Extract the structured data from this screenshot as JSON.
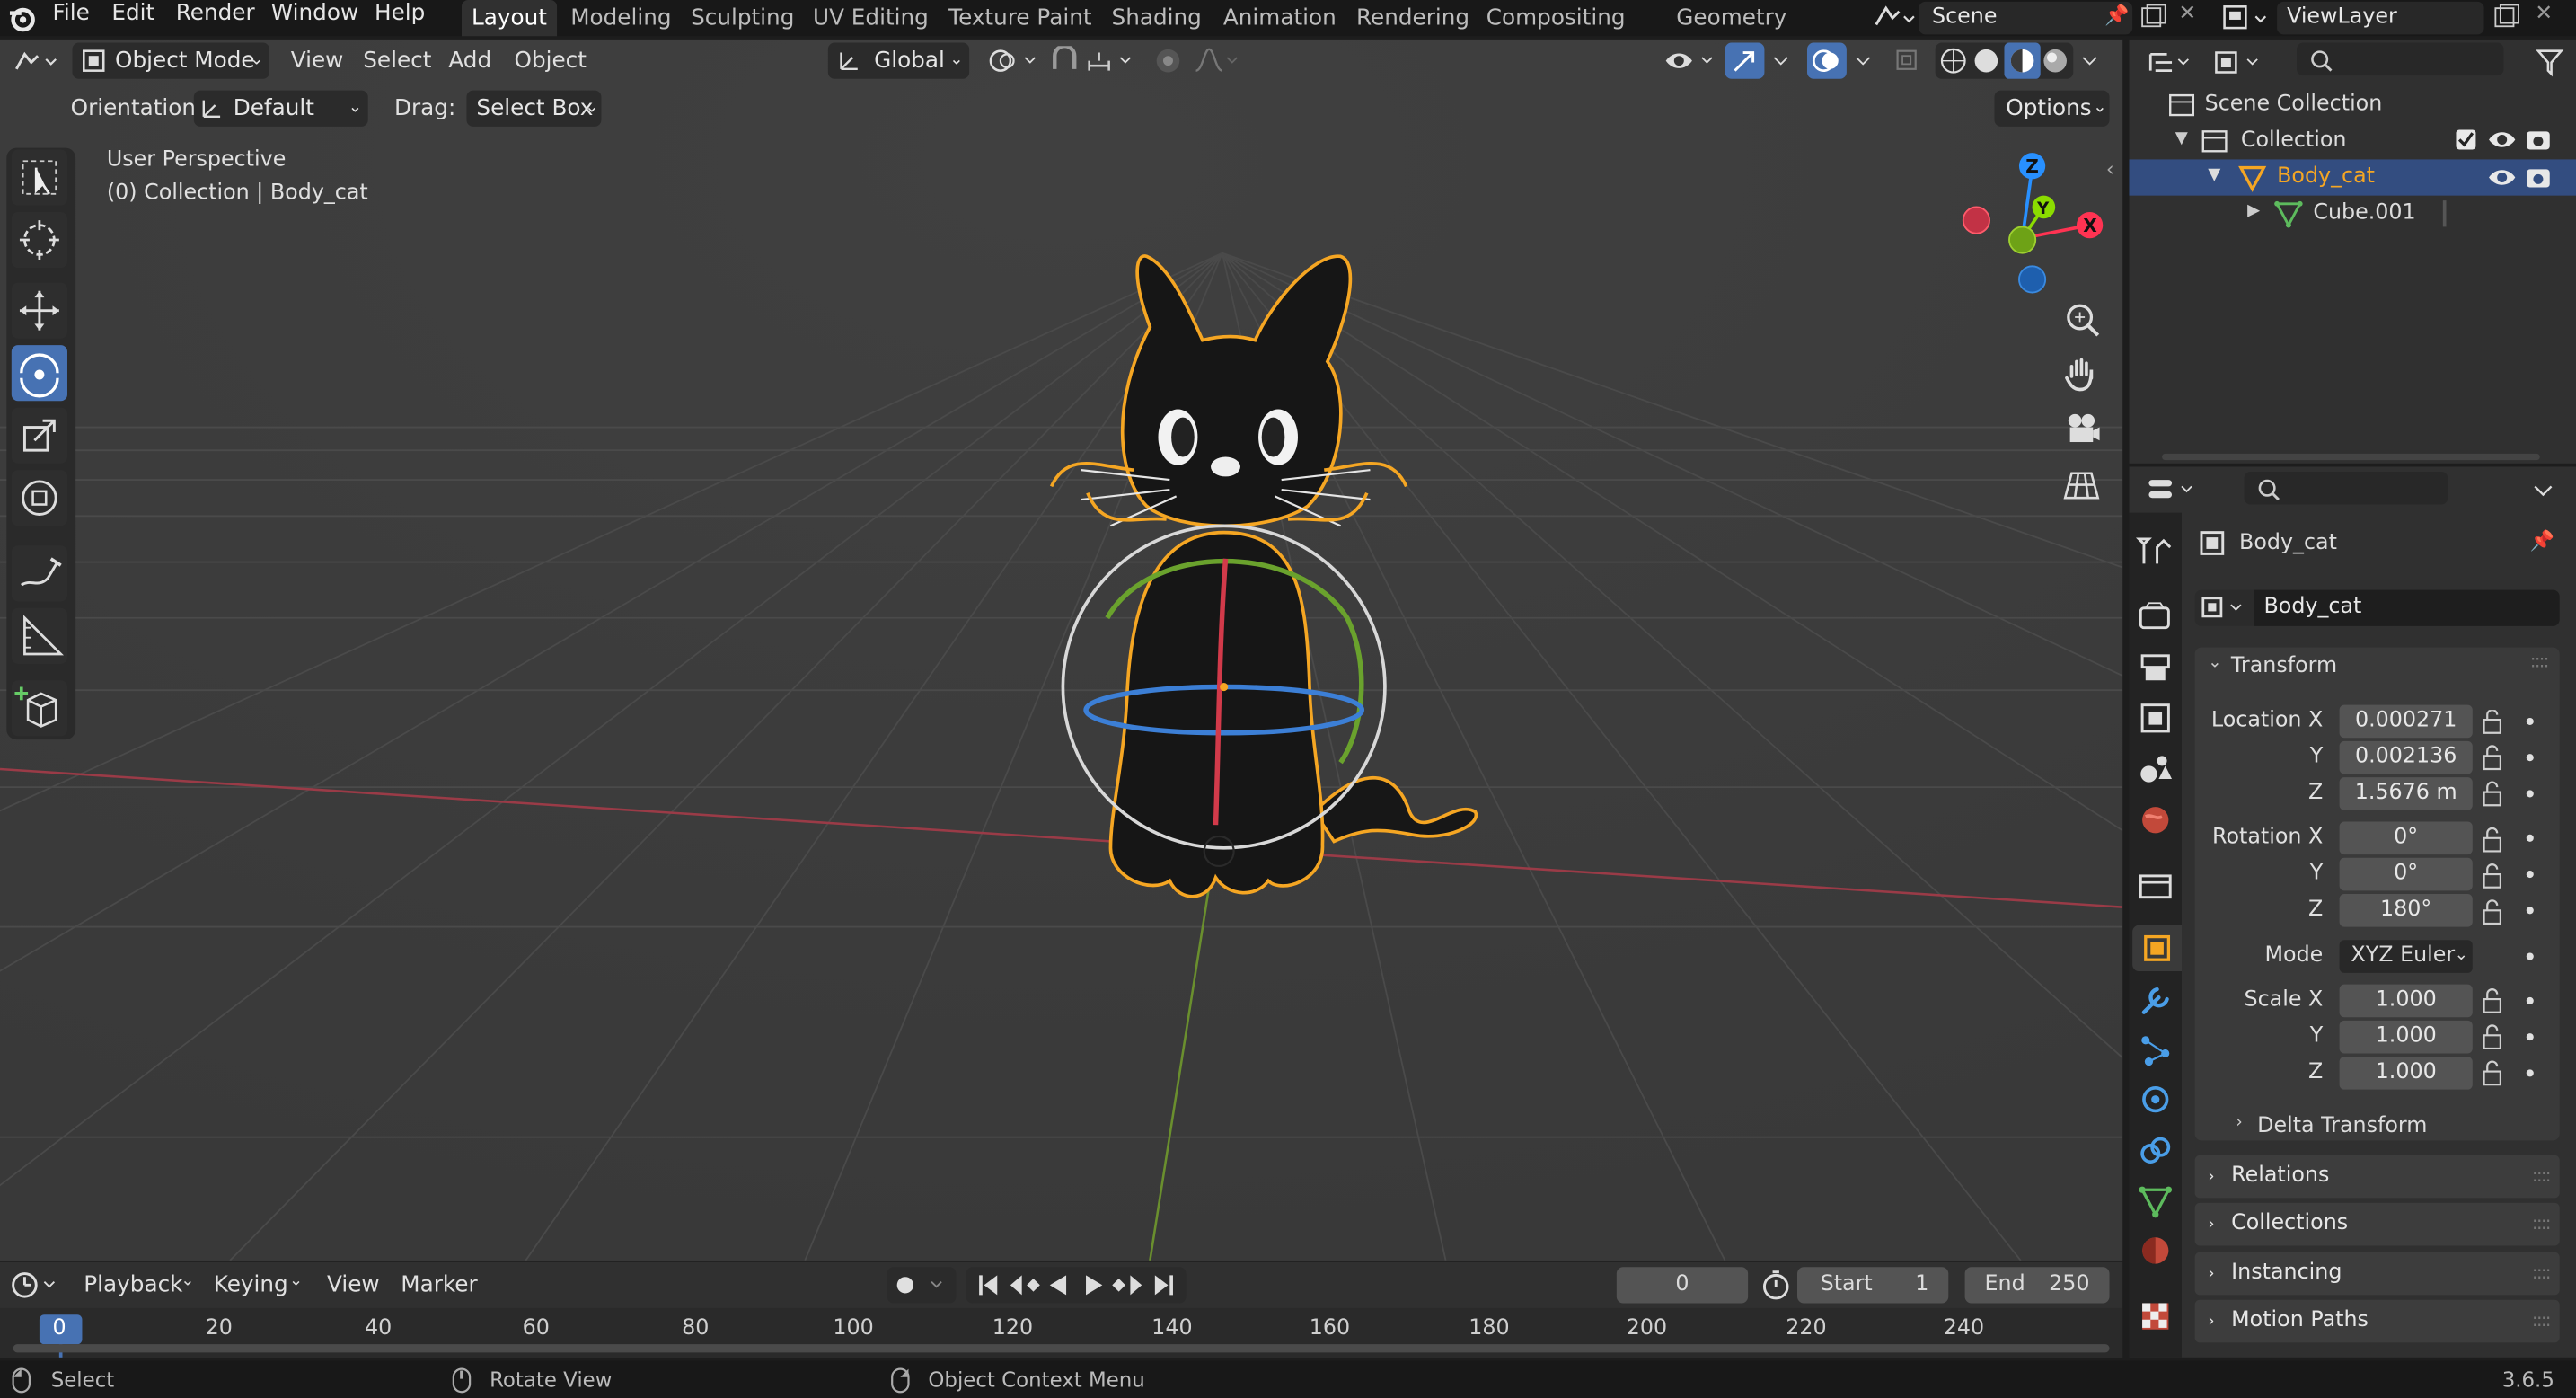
{
  "top_menu": {
    "items": [
      "File",
      "Edit",
      "Render",
      "Window",
      "Help"
    ]
  },
  "workspaces": {
    "tabs": [
      "Layout",
      "Modeling",
      "Sculpting",
      "UV Editing",
      "Texture Paint",
      "Shading",
      "Animation",
      "Rendering",
      "Compositing",
      "Geometry Nodes"
    ],
    "active": "Layout"
  },
  "scene": {
    "name": "Scene",
    "view_layer": "ViewLayer"
  },
  "viewport_header": {
    "mode": "Object Mode",
    "menus": [
      "View",
      "Select",
      "Add",
      "Object"
    ],
    "transform_orientation": "Global",
    "orientation_label": "Orientation:",
    "orientation_value": "Default",
    "drag_label": "Drag:",
    "drag_value": "Select Box",
    "options": "Options"
  },
  "viewport_info": {
    "line1": "User Perspective",
    "line2": "(0) Collection | Body_cat"
  },
  "gizmo": {
    "x": "X",
    "y": "Y",
    "z": "Z"
  },
  "outliner": {
    "root": "Scene Collection",
    "collection": "Collection",
    "active_object": "Body_cat",
    "child": "Cube.001"
  },
  "properties": {
    "object_name": "Body_cat",
    "object_field": "Body_cat",
    "transform_panel": "Transform",
    "location_label": "Location X",
    "location": {
      "x": "0.000271",
      "y": "0.002136",
      "z": "1.5676 m"
    },
    "rotation_label": "Rotation X",
    "rotation": {
      "x": "0°",
      "y": "0°",
      "z": "180°"
    },
    "mode_label": "Mode",
    "mode_value": "XYZ Euler",
    "scale_label": "Scale X",
    "scale": {
      "x": "1.000",
      "y": "1.000",
      "z": "1.000"
    },
    "y_label": "Y",
    "z_label": "Z",
    "delta": "Delta Transform",
    "subpanels": [
      "Relations",
      "Collections",
      "Instancing",
      "Motion Paths"
    ]
  },
  "timeline": {
    "menus": [
      "Playback",
      "Keying",
      "View",
      "Marker"
    ],
    "current_frame": "0",
    "start_label": "Start",
    "start": "1",
    "end_label": "End",
    "end": "250",
    "ticks": [
      "0",
      "20",
      "40",
      "60",
      "80",
      "100",
      "120",
      "140",
      "160",
      "180",
      "200",
      "220",
      "240"
    ]
  },
  "statusbar": {
    "select": "Select",
    "rotate": "Rotate View",
    "context": "Object Context Menu",
    "version": "3.6.5"
  },
  "colors": {
    "accent": "#4772b3",
    "selection_orange": "#f5a623",
    "x_axis": "#ff3352",
    "y_axis": "#8bdc00",
    "z_axis": "#2890ff"
  }
}
